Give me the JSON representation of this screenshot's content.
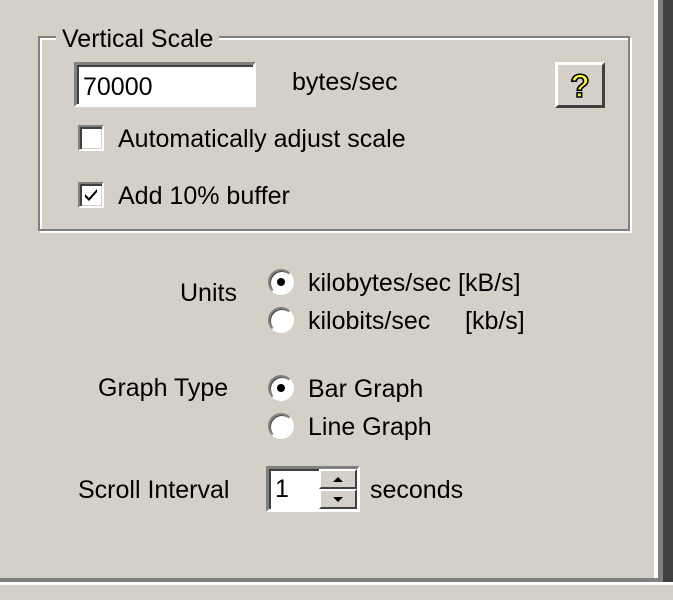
{
  "vertical_scale": {
    "title": "Vertical Scale",
    "value": "70000",
    "unit": "bytes/sec",
    "help_icon": "question-help-icon",
    "auto_adjust": {
      "label": "Automatically adjust scale",
      "checked": false
    },
    "add_buffer": {
      "label": "Add 10% buffer",
      "checked": true
    }
  },
  "units": {
    "label": "Units",
    "options": [
      {
        "label": "kilobytes/sec [kB/s]",
        "selected": true
      },
      {
        "label": "kilobits/sec     [kb/s]",
        "selected": false
      }
    ]
  },
  "graph_type": {
    "label": "Graph Type",
    "options": [
      {
        "label": "Bar Graph",
        "selected": true
      },
      {
        "label": "Line Graph",
        "selected": false
      }
    ]
  },
  "scroll_interval": {
    "label": "Scroll Interval",
    "value": "1",
    "unit": "seconds"
  }
}
